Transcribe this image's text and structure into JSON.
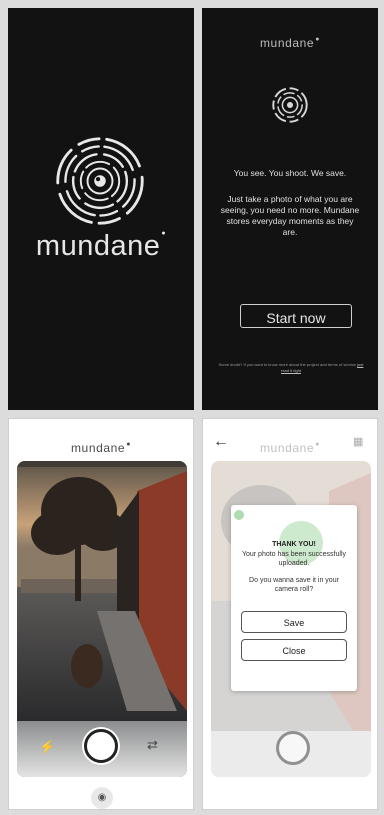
{
  "splash": {
    "wordmark": "mundane"
  },
  "onboarding": {
    "brand": "mundane",
    "tagline": "You see. You shoot. We save.",
    "description": "Just take a photo of what you are seeing, you need no more. Mundane stores everyday moments as they are.",
    "start_label": "Start now",
    "fine_print": "Some doubt? If you want to know more about the project and terms of service",
    "fine_link": "just read it right"
  },
  "camera": {
    "brand": "mundane"
  },
  "upload": {
    "brand": "mundane",
    "title": "THANK YOU!",
    "message": "Your photo has been successfully uploaded.",
    "question": "Do you wanna save it in your camera roll?",
    "save_label": "Save",
    "close_label": "Close"
  },
  "colors": {
    "dark_bg": "#121212",
    "success": "#4caf50"
  },
  "icons": [
    "mundane-logo-icon",
    "flash-icon",
    "switch-camera-icon",
    "eye-icon",
    "back-arrow-icon",
    "gallery-icon"
  ]
}
